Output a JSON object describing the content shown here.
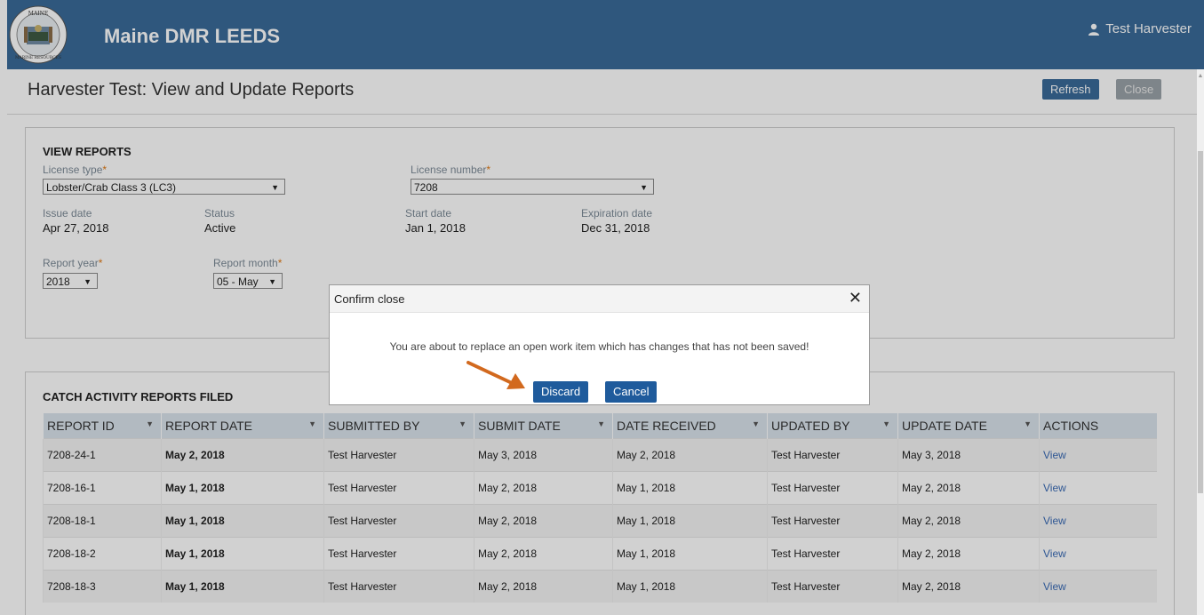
{
  "app": {
    "title": "Maine DMR LEEDS",
    "user": "Test Harvester",
    "logo_text_top": "MAINE",
    "logo_text_bottom": "MARINE RESOURCES"
  },
  "page": {
    "title": "Harvester Test: View and Update Reports",
    "refresh_label": "Refresh",
    "close_label": "Close"
  },
  "view_reports": {
    "heading": "VIEW REPORTS",
    "license_type_label": "License type",
    "license_type_value": "Lobster/Crab Class 3 (LC3)",
    "license_number_label": "License number",
    "license_number_value": "7208",
    "issue_date_label": "Issue date",
    "issue_date": "Apr 27, 2018",
    "status_label": "Status",
    "status": "Active",
    "start_date_label": "Start date",
    "start_date": "Jan 1, 2018",
    "expiration_date_label": "Expiration date",
    "expiration_date": "Dec 31, 2018",
    "report_year_label": "Report year",
    "report_year": "2018",
    "report_month_label": "Report month",
    "report_month": "05 - May",
    "required_mark": "*"
  },
  "catch_reports": {
    "heading": "CATCH ACTIVITY REPORTS FILED",
    "columns": [
      "REPORT ID",
      "REPORT DATE",
      "SUBMITTED BY",
      "SUBMIT DATE",
      "DATE RECEIVED",
      "UPDATED BY",
      "UPDATE DATE",
      "ACTIONS"
    ],
    "rows": [
      [
        "7208-24-1",
        "May 2, 2018",
        "Test Harvester",
        "May 3, 2018",
        "May 2, 2018",
        "Test Harvester",
        "May 3, 2018",
        "View"
      ],
      [
        "7208-16-1",
        "May 1, 2018",
        "Test Harvester",
        "May 2, 2018",
        "May 1, 2018",
        "Test Harvester",
        "May 2, 2018",
        "View"
      ],
      [
        "7208-18-1",
        "May 1, 2018",
        "Test Harvester",
        "May 2, 2018",
        "May 1, 2018",
        "Test Harvester",
        "May 2, 2018",
        "View"
      ],
      [
        "7208-18-2",
        "May 1, 2018",
        "Test Harvester",
        "May 2, 2018",
        "May 1, 2018",
        "Test Harvester",
        "May 2, 2018",
        "View"
      ],
      [
        "7208-18-3",
        "May 1, 2018",
        "Test Harvester",
        "May 2, 2018",
        "May 1, 2018",
        "Test Harvester",
        "May 2, 2018",
        "View"
      ]
    ]
  },
  "dialog": {
    "title": "Confirm close",
    "close_glyph": "✕",
    "message": "You are about to replace an open work item which has changes that has not been saved!",
    "discard_label": "Discard",
    "cancel_label": "Cancel"
  },
  "colors": {
    "brand": "#3a6b99",
    "required": "#e07a17",
    "dialog_button": "#1f5b9c",
    "annotation_arrow": "#d2691e"
  },
  "icons": {
    "user": "user-icon",
    "dropdown": "chevron-down-icon",
    "sort": "sort-icon",
    "close": "close-icon"
  }
}
